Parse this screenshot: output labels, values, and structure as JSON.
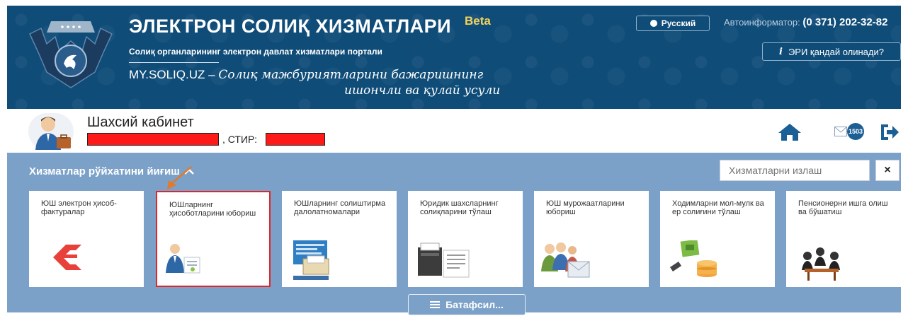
{
  "header": {
    "title": "ЭЛЕКТРОН СОЛИҚ ХИЗМАТЛАРИ",
    "beta": "Beta",
    "subtitle": "Солиқ органларининг электрон давлат хизматлари портали",
    "slogan_site": "MY.SOLIQ.UZ",
    "slogan_dash": "–",
    "slogan_line1": "Солиқ мажбуриятларини бажаришнинг",
    "slogan_line2": "ишончли ва қулай усули",
    "language_button": "Русский",
    "autoinformer_label": "Автоинформатор:",
    "autoinformer_phone": "(0 371) 202-32-82",
    "eri_button": "ЭРИ қандай олинади?",
    "eri_icon_glyph": "i"
  },
  "cabinet": {
    "title": "Шахсий кабинет",
    "stir_label": ", СТИР:",
    "message_count": "1503"
  },
  "services": {
    "collapse_label": "Хизматлар рўйхатини йиғиш",
    "search_placeholder": "Хизматларни излаш",
    "close_glyph": "×",
    "more_button": "Батафсил...",
    "tiles": [
      {
        "label": "ЮШ электрон ҳисоб-фактуралар",
        "icon": "invoice-logo-icon"
      },
      {
        "label": "ЮШларнинг ҳисоботларини юбориш",
        "icon": "report-submit-icon"
      },
      {
        "label": "ЮШларнинг солиштирма далолатномалари",
        "icon": "reconciliation-icon"
      },
      {
        "label": "Юридик шахсларнинг солиқларини тўлаш",
        "icon": "tax-payment-icon"
      },
      {
        "label": "ЮШ мурожаатларини юбориш",
        "icon": "appeal-icon"
      },
      {
        "label": "Ходимларни мол-мулк ва ер солиғини тўлаш",
        "icon": "property-tax-icon"
      },
      {
        "label": "Пенсионерни ишга олиш ва бўшатиш",
        "icon": "pensioner-icon"
      }
    ]
  },
  "colors": {
    "header_bg": "#0f4c78",
    "panel_bg": "#7ba1c8",
    "beta": "#f3d35b",
    "highlight_border": "#e0262a",
    "redaction": "#ff1a1a",
    "annotation_arrow": "#e27a2b"
  }
}
